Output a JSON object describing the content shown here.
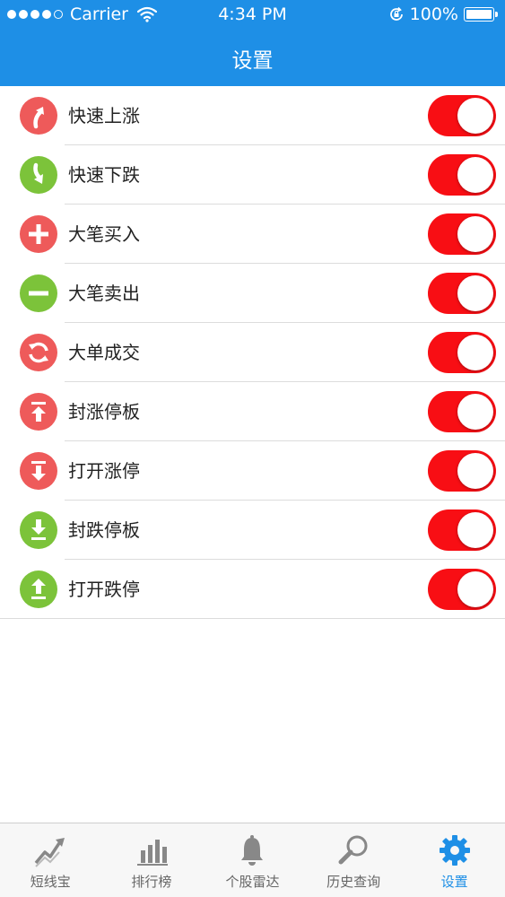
{
  "status_bar": {
    "carrier": "Carrier",
    "time": "4:34 PM",
    "battery": "100%"
  },
  "nav": {
    "title": "设置"
  },
  "colors": {
    "accent": "#1e8fe6",
    "toggle_on": "#f80e14",
    "icon_red": "#ee5a5a",
    "icon_green": "#7cc33a"
  },
  "settings": [
    {
      "label": "快速上涨",
      "icon": "curved-arrow-up-icon",
      "color": "red",
      "enabled": true
    },
    {
      "label": "快速下跌",
      "icon": "curved-arrow-down-icon",
      "color": "green",
      "enabled": true
    },
    {
      "label": "大笔买入",
      "icon": "plus-icon",
      "color": "red",
      "enabled": true
    },
    {
      "label": "大笔卖出",
      "icon": "minus-icon",
      "color": "green",
      "enabled": true
    },
    {
      "label": "大单成交",
      "icon": "refresh-icon",
      "color": "red",
      "enabled": true
    },
    {
      "label": "封涨停板",
      "icon": "arrow-up-to-bar-icon",
      "color": "red",
      "enabled": true
    },
    {
      "label": "打开涨停",
      "icon": "arrow-down-from-bar-icon",
      "color": "red",
      "enabled": true
    },
    {
      "label": "封跌停板",
      "icon": "arrow-down-to-bar-icon",
      "color": "green",
      "enabled": true
    },
    {
      "label": "打开跌停",
      "icon": "arrow-up-from-bar-icon",
      "color": "green",
      "enabled": true
    }
  ],
  "tabs": [
    {
      "label": "短线宝",
      "icon": "trend-chart-icon",
      "active": false
    },
    {
      "label": "排行榜",
      "icon": "bar-chart-icon",
      "active": false
    },
    {
      "label": "个股雷达",
      "icon": "bell-icon",
      "active": false
    },
    {
      "label": "历史查询",
      "icon": "search-icon",
      "active": false
    },
    {
      "label": "设置",
      "icon": "gear-icon",
      "active": true
    }
  ]
}
